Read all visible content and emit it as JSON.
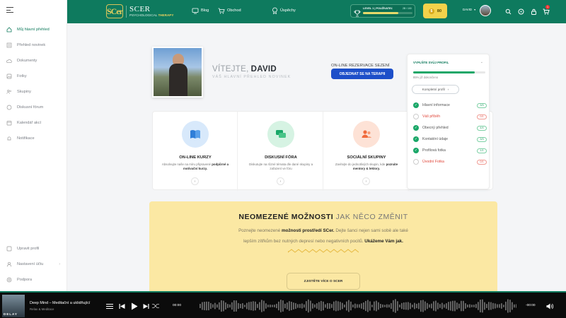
{
  "sidebar": {
    "items": [
      {
        "label": "Můj hlavní přehled",
        "icon": "home-icon",
        "active": true
      },
      {
        "label": "Přehled novinek",
        "icon": "news-icon"
      },
      {
        "label": "Dokumenty",
        "icon": "cloud-icon"
      },
      {
        "label": "Fotky",
        "icon": "image-icon"
      },
      {
        "label": "Skupiny",
        "icon": "users-icon"
      },
      {
        "label": "Diskusní fórum",
        "icon": "chat-icon"
      },
      {
        "label": "Kalendář akcí",
        "icon": "calendar-icon"
      },
      {
        "label": "Notifikace",
        "icon": "bell-icon"
      }
    ],
    "bottom": [
      {
        "label": "Upravit profil",
        "icon": "edit-icon"
      },
      {
        "label": "Nastavení účtu",
        "icon": "settings-icon"
      },
      {
        "label": "Podpora",
        "icon": "support-icon"
      }
    ]
  },
  "topbar": {
    "logo_mark": "SCer",
    "logo_title": "SCER",
    "logo_sub1": "PSYCHOLOGICAL",
    "logo_sub2": "THERAPY",
    "nav": [
      {
        "label": "Blog",
        "icon": "monitor-icon"
      },
      {
        "label": "Obchod",
        "icon": "cart-icon"
      },
      {
        "label": "Úspěchy",
        "icon": "medal-icon"
      }
    ],
    "level_label": "LEVEL 1 | POUŽÍVATEĽ",
    "level_value": "2B / 100",
    "level_progress": 0.72,
    "coins": "80",
    "user_name": "DAVID",
    "notification_count": "1"
  },
  "hero": {
    "welcome": "VÍTEJTE,",
    "name": "DAVID",
    "subtitle": "VÁŠ HLAVNÍ PŘEHLED NOVINEK",
    "reservation_label": "ON-LINE REZERVACE SEZENÍ",
    "order_button": "OBJEDNAT SE NA TERAPII"
  },
  "cards": [
    {
      "title": "ON-LINE KURZY",
      "desc1": "Absolvujte naše na míru připravené",
      "desc2": "podpůrné a motivační kurzy.",
      "color": "#d8e9fb",
      "icon": "book-icon"
    },
    {
      "title": "DISKUSNÍ FÓRA",
      "desc1": "Diskutujte na různé témata dle dané",
      "desc2": "skupiny a zařazení ve fóru",
      "color": "#d6f3e3",
      "icon": "chat-icon"
    },
    {
      "title": "SOCIÁLNÍ SKUPINY",
      "desc1": "Zavítejte do jednotlivých skupin, kde",
      "desc2": "poznáte mentory & lektory.",
      "color": "#fde2d6",
      "icon": "users-icon"
    },
    {
      "title": "",
      "desc1": "",
      "desc2": "",
      "color": "#ffffff",
      "icon": ""
    }
  ],
  "profile": {
    "title": "VYPLŇTE SVŮJ PROFIL",
    "percent_text": "85% již dokončeno",
    "percent": 0.85,
    "complete_button": "Kompletní profil",
    "items": [
      {
        "label": "Hlavní informace",
        "count": "3/3",
        "done": true
      },
      {
        "label": "Váš příběh",
        "count": "0/1",
        "done": false
      },
      {
        "label": "Obecný přehled",
        "count": "4/4",
        "done": true
      },
      {
        "label": "Kontaktní údaje",
        "count": "3/3",
        "done": true
      },
      {
        "label": "Profilová fotka",
        "count": "1/1",
        "done": true
      },
      {
        "label": "Úvodní Fotka",
        "count": "0/1",
        "done": false
      }
    ]
  },
  "banner": {
    "title_bold": "NEOMEZENÉ MOŽNOSTI",
    "title_rest": "JAK NĚCO ZMĚNIT",
    "l1a": "Poznejte neomezené",
    "l1b": "možnosti prostředí SCer.",
    "l1c": "Dejte šanci nejen sami sobě ale také",
    "l2a": "lepším zítřkům bez nutných depresí nebo negativních pocitů.",
    "l2b": "Ukážeme Vám jak.",
    "button": "ZJISTĚTE VÍCE O SCER"
  },
  "player": {
    "cover_text": "DELAY",
    "track": "Deep Mind – Meditační a uklidňující",
    "artist": "Relax & Meditace",
    "time_current": "00:00",
    "time_remaining": "-00:00"
  }
}
